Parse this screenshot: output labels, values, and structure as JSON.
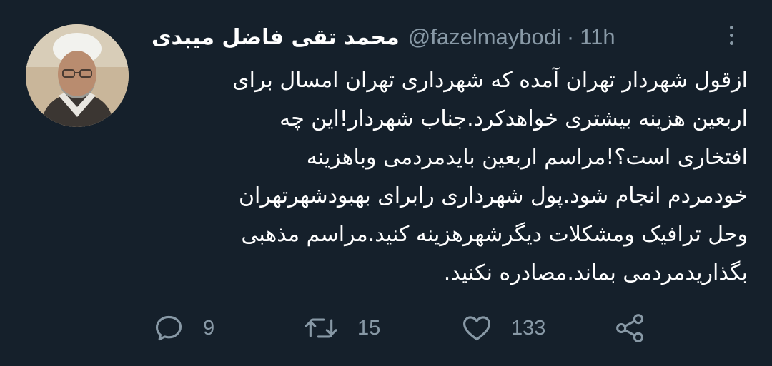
{
  "tweet": {
    "author": {
      "display_name": "محمد تقی فاضل میبدی",
      "handle": "@fazelmaybodi",
      "separator": "·",
      "time": "11h"
    },
    "text_lines": [
      "ازقول شهردار تهران آمده که شهرداری تهران امسال برای",
      "اربعین هزینه بیشتری خواهدکرد.جناب شهردار!این چه",
      "افتخاری است؟!مراسم اربعین بایدمردمی وباهزینه",
      "خودمردم انجام شود.پول شهرداری رابرای بهبودشهرتهران",
      "وحل ترافیک ومشکلات دیگرشهرهزینه کنید.مراسم مذهبی",
      "بگذاریدمردمی بماند.مصادره نکنید."
    ],
    "actions": {
      "reply": {
        "icon": "reply-icon",
        "count": "9"
      },
      "retweet": {
        "icon": "retweet-icon",
        "count": "15"
      },
      "like": {
        "icon": "heart-icon",
        "count": "133"
      },
      "share": {
        "icon": "share-icon"
      }
    }
  },
  "colors": {
    "background": "#15202b",
    "text": "#ffffff",
    "secondary": "#8899a6"
  }
}
